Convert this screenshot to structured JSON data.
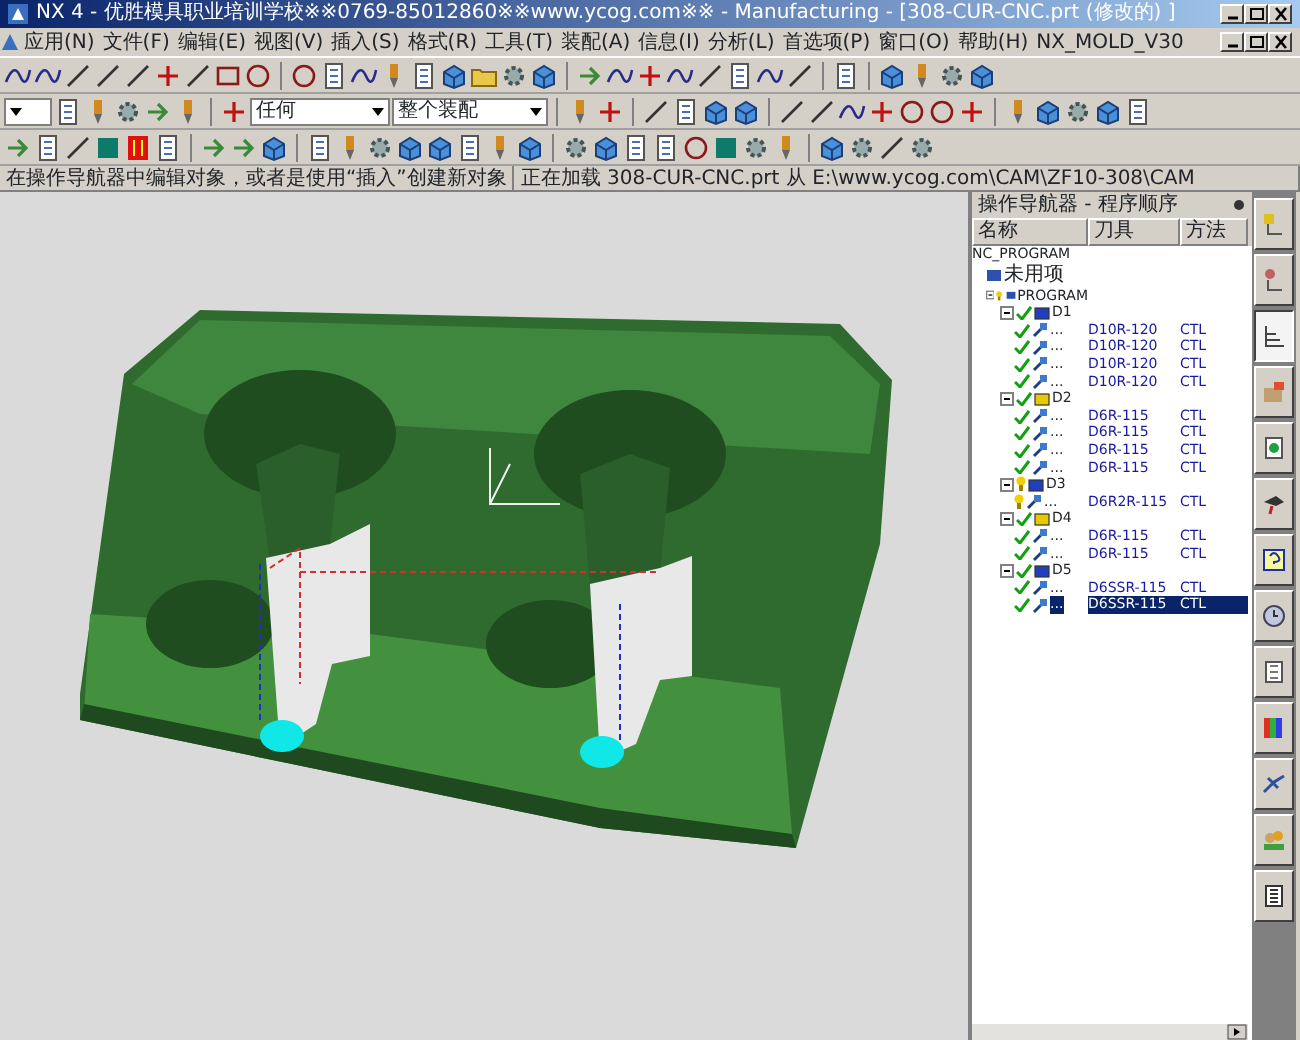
{
  "window": {
    "title": "NX 4 - 优胜模具职业培训学校※※0769-85012860※※www.ycog.com※※ - Manufacturing - [308-CUR-CNC.prt (修改的) ]"
  },
  "menu": [
    "应用(N)",
    "文件(F)",
    "编辑(E)",
    "视图(V)",
    "插入(S)",
    "格式(R)",
    "工具(T)",
    "装配(A)",
    "信息(I)",
    "分析(L)",
    "首选项(P)",
    "窗口(O)",
    "帮助(H)",
    "NX_MOLD_V30"
  ],
  "toolbar": {
    "dropdowns": [
      {
        "value": "任何"
      },
      {
        "value": "整个装配"
      }
    ]
  },
  "status_bar": {
    "prompt": "在操作导航器中编辑对象，或者是使用“插入”创建新对象",
    "message": "正在加载 308-CUR-CNC.prt 从 E:\\www.ycog.com\\CAM\\ZF10-308\\CAM"
  },
  "navigator": {
    "title": "操作导航器 - 程序顺序",
    "columns": [
      "名称",
      "刀具",
      "方法"
    ],
    "tree": [
      {
        "name": "NC_PROGRAM",
        "selected": false,
        "children": [
          {
            "name": "未用项",
            "kind": "unused",
            "selected": false
          },
          {
            "name": "PROGRAM",
            "kind": "program",
            "generated": false,
            "expanded": true,
            "selected": false,
            "children": [
              {
                "name": "D1",
                "kind": "group",
                "generated": true,
                "color": "#1f3fbf",
                "expanded": true,
                "selected": false,
                "children": [
                  {
                    "name": "...",
                    "kind": "operation",
                    "generated": true,
                    "tool": "D10R-120",
                    "method": "CTL",
                    "selected": false
                  },
                  {
                    "name": "...",
                    "kind": "operation",
                    "generated": true,
                    "tool": "D10R-120",
                    "method": "CTL",
                    "selected": false
                  },
                  {
                    "name": "...",
                    "kind": "operation",
                    "generated": true,
                    "tool": "D10R-120",
                    "method": "CTL",
                    "selected": false
                  },
                  {
                    "name": "...",
                    "kind": "operation",
                    "generated": true,
                    "tool": "D10R-120",
                    "method": "CTL",
                    "selected": false
                  }
                ]
              },
              {
                "name": "D2",
                "kind": "group",
                "generated": true,
                "color": "#e8c800",
                "expanded": true,
                "selected": false,
                "children": [
                  {
                    "name": "...",
                    "kind": "operation",
                    "generated": true,
                    "tool": "D6R-115",
                    "method": "CTL",
                    "selected": false
                  },
                  {
                    "name": "...",
                    "kind": "operation",
                    "generated": true,
                    "tool": "D6R-115",
                    "method": "CTL",
                    "selected": false
                  },
                  {
                    "name": "...",
                    "kind": "operation",
                    "generated": true,
                    "tool": "D6R-115",
                    "method": "CTL",
                    "selected": false
                  },
                  {
                    "name": "...",
                    "kind": "operation",
                    "generated": true,
                    "tool": "D6R-115",
                    "method": "CTL",
                    "selected": false
                  }
                ]
              },
              {
                "name": "D3",
                "kind": "group",
                "generated": false,
                "color": "#1f3fbf",
                "expanded": true,
                "selected": false,
                "children": [
                  {
                    "name": "...",
                    "kind": "operation",
                    "generated": false,
                    "tool": "D6R2R-115",
                    "method": "CTL",
                    "selected": false
                  }
                ]
              },
              {
                "name": "D4",
                "kind": "group",
                "generated": true,
                "color": "#e8c800",
                "expanded": true,
                "selected": false,
                "children": [
                  {
                    "name": "...",
                    "kind": "operation",
                    "generated": true,
                    "tool": "D6R-115",
                    "method": "CTL",
                    "selected": false
                  },
                  {
                    "name": "...",
                    "kind": "operation",
                    "generated": true,
                    "tool": "D6R-115",
                    "method": "CTL",
                    "selected": false
                  }
                ]
              },
              {
                "name": "D5",
                "kind": "group",
                "generated": true,
                "color": "#1f3fbf",
                "expanded": true,
                "selected": false,
                "children": [
                  {
                    "name": "...",
                    "kind": "operation",
                    "generated": true,
                    "tool": "D6SSR-115",
                    "method": "CTL",
                    "selected": false
                  },
                  {
                    "name": "...",
                    "kind": "operation",
                    "generated": true,
                    "tool": "D6SSR-115",
                    "method": "CTL",
                    "selected": true
                  }
                ]
              }
            ]
          }
        ]
      }
    ]
  },
  "resource_bar": {
    "tabs": [
      {
        "selected": false
      },
      {
        "selected": false
      },
      {
        "selected": true
      },
      {
        "selected": false
      },
      {
        "selected": false
      },
      {
        "selected": false
      },
      {
        "selected": false
      },
      {
        "selected": false
      },
      {
        "selected": false
      },
      {
        "selected": false
      },
      {
        "selected": false
      },
      {
        "selected": false
      },
      {
        "selected": false
      }
    ]
  }
}
